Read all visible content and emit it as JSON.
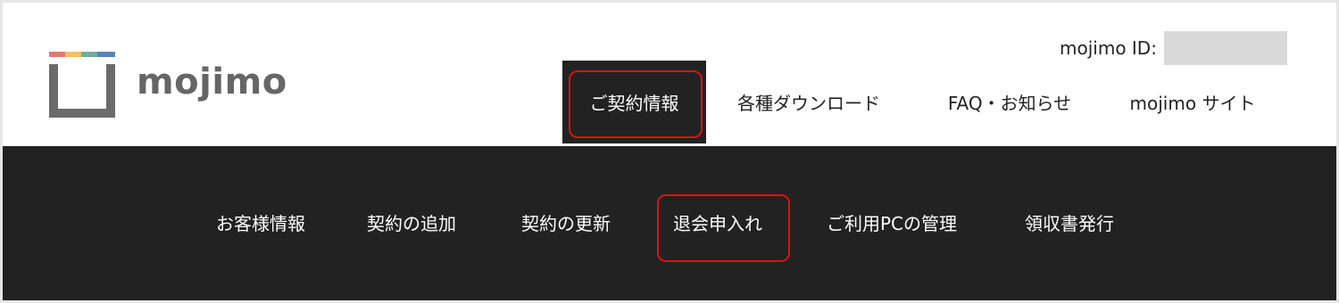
{
  "brand": {
    "name": "mojimo",
    "colors": {
      "bar1": "#e8786e",
      "bar2": "#f3c15d",
      "bar3": "#6fae9f",
      "bar4": "#5b83b8",
      "mark": "#6b6b6b"
    }
  },
  "account": {
    "id_label": "mojimo ID:",
    "id_value": ""
  },
  "top_nav": {
    "items": [
      {
        "label": "ご契約情報",
        "active": true
      },
      {
        "label": "各種ダウンロード",
        "active": false
      },
      {
        "label": "FAQ・お知らせ",
        "active": false
      },
      {
        "label": "mojimo サイト",
        "active": false
      }
    ]
  },
  "sub_nav": {
    "items": [
      {
        "label": "お客様情報"
      },
      {
        "label": "契約の追加"
      },
      {
        "label": "契約の更新"
      },
      {
        "label": "退会申入れ",
        "highlighted": true
      },
      {
        "label": "ご利用PCの管理"
      },
      {
        "label": "領収書発行"
      }
    ]
  },
  "theme": {
    "dark": "#222222",
    "highlight": "#e01010",
    "id_box": "#d9d9d9"
  }
}
